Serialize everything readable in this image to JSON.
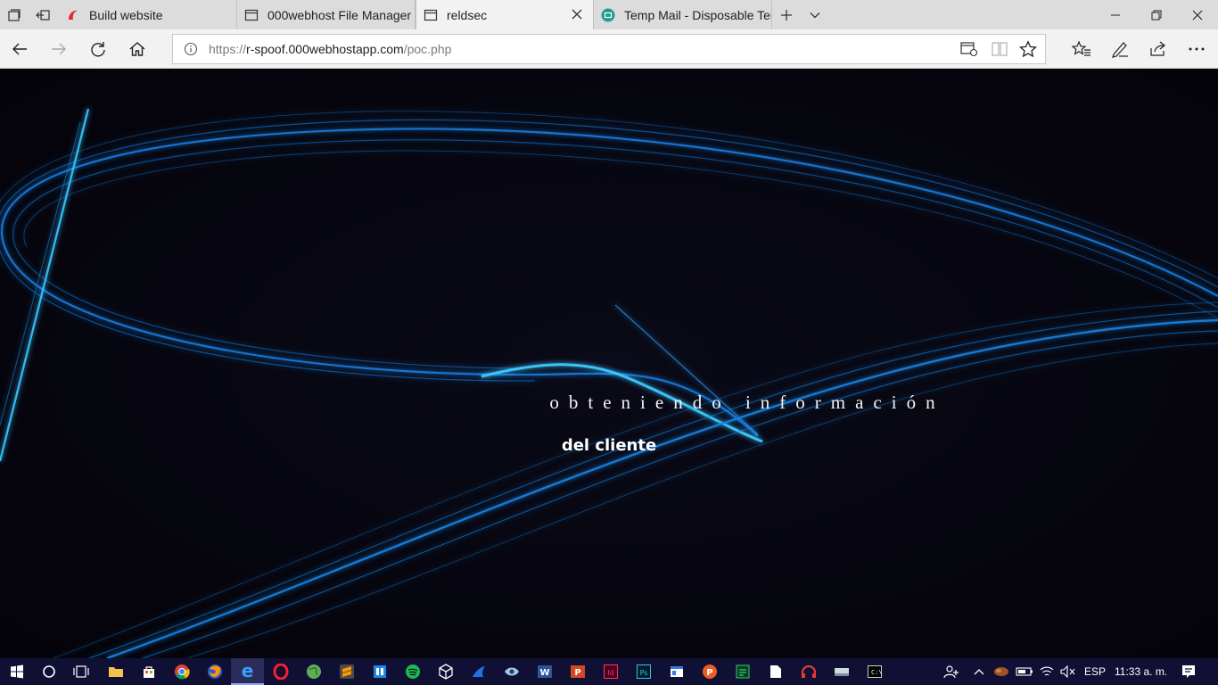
{
  "browser": {
    "tabs": [
      {
        "title": "Build website",
        "icon": "000webhost-logo-icon",
        "active": false
      },
      {
        "title": "000webhost File Manager",
        "icon": "page-icon",
        "active": false
      },
      {
        "title": "reldsec",
        "icon": "page-icon",
        "active": true
      },
      {
        "title": "Temp Mail - Disposable Ten",
        "icon": "tempmail-logo-icon",
        "active": false
      }
    ],
    "url_prefix": "https://",
    "url_host": "r-spoof.000webhostapp.com",
    "url_path": "/poc.php"
  },
  "page": {
    "heading": "obteniendo información",
    "subheading": "del cliente",
    "background_color": "#06040d",
    "accent_color": "#1e8cff"
  },
  "taskbar": {
    "language": "ESP",
    "clock": "11:33 a. m.",
    "apps": [
      "file-explorer-icon",
      "store-icon",
      "chrome-icon",
      "firefox-icon",
      "edge-icon",
      "opera-icon",
      "globe-app-icon",
      "sublime-text-icon",
      "remote-desktop-icon",
      "spotify-icon",
      "virtualbox-icon",
      "shark-app-icon",
      "eye-app-icon",
      "word-icon",
      "powerpoint-icon",
      "indesign-icon",
      "photoshop-icon",
      "window-app-icon",
      "postman-icon",
      "terminal-app-icon",
      "document-icon",
      "headset-app-icon",
      "drive-icon",
      "cmd-icon"
    ]
  }
}
